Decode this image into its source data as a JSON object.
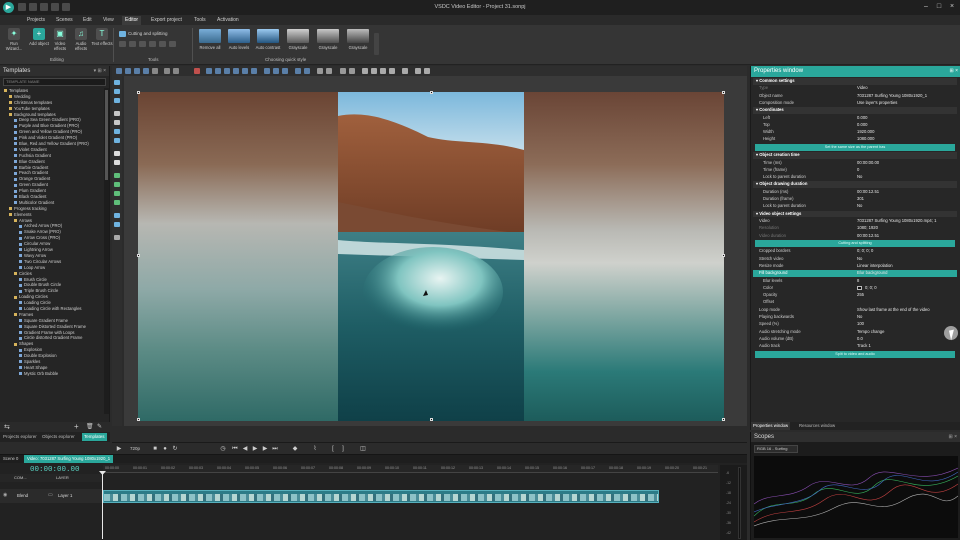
{
  "window": {
    "title": "VSDC Video Editor - Project 31.sonpj"
  },
  "menu_tabs": [
    "Projects",
    "Scenes",
    "Edit",
    "View",
    "Editor",
    "Export project",
    "Tools",
    "Activation"
  ],
  "active_menu_tab": "Editor",
  "ribbon": {
    "run_wizard": "Run Wizard...",
    "add_object": "Add object",
    "video_effects": "Video effects",
    "audio_effects": "Audio effects",
    "text_effects": "Text effects",
    "editing_group": "Editing",
    "cutting_splitting": "Cutting and splitting",
    "tools_group": "Tools",
    "quick_style_group": "Choosing quick style",
    "quick_styles": [
      "Remove all",
      "Auto levels",
      "Auto contrast",
      "Grayscale",
      "Grayscale",
      "Grayscale"
    ]
  },
  "templates": {
    "title": "Templates",
    "search_placeholder": "TEMPLATE NAME",
    "items": [
      {
        "label": "Templates",
        "level": 0,
        "folder": true
      },
      {
        "label": "Wedding",
        "level": 1,
        "folder": true
      },
      {
        "label": "Christmas templates",
        "level": 1,
        "folder": true
      },
      {
        "label": "YouTube templates",
        "level": 1,
        "folder": true
      },
      {
        "label": "Background templates",
        "level": 1,
        "folder": true
      },
      {
        "label": "Deep Sea Green Gradient (PRO)",
        "level": 2,
        "folder": false
      },
      {
        "label": "Purple and Blue Gradient (PRO)",
        "level": 2,
        "folder": false
      },
      {
        "label": "Green and Yellow Gradient (PRO)",
        "level": 2,
        "folder": false
      },
      {
        "label": "Pink and Violet Gradient (PRO)",
        "level": 2,
        "folder": false
      },
      {
        "label": "Blue, Red and Yellow Gradient (PRO)",
        "level": 2,
        "folder": false
      },
      {
        "label": "Violet Gradient",
        "level": 2,
        "folder": false
      },
      {
        "label": "Fuchsia Gradient",
        "level": 2,
        "folder": false
      },
      {
        "label": "Blue Gradient",
        "level": 2,
        "folder": false
      },
      {
        "label": "Barbie Gradient",
        "level": 2,
        "folder": false
      },
      {
        "label": "Peach Gradient",
        "level": 2,
        "folder": false
      },
      {
        "label": "Orange Gradient",
        "level": 2,
        "folder": false
      },
      {
        "label": "Green Gradient",
        "level": 2,
        "folder": false
      },
      {
        "label": "Plum Gradient",
        "level": 2,
        "folder": false
      },
      {
        "label": "Black Gradient",
        "level": 2,
        "folder": false
      },
      {
        "label": "Multicolor Gradient",
        "level": 2,
        "folder": false
      },
      {
        "label": "Progress tracking",
        "level": 1,
        "folder": true
      },
      {
        "label": "Elements",
        "level": 1,
        "folder": true
      },
      {
        "label": "Arrows",
        "level": 2,
        "folder": true
      },
      {
        "label": "Arched Arrow (PRO)",
        "level": 3,
        "folder": false
      },
      {
        "label": "Snake Arrow (PRO)",
        "level": 3,
        "folder": false
      },
      {
        "label": "Arrow Cross (PRO)",
        "level": 3,
        "folder": false
      },
      {
        "label": "Circular Arrow",
        "level": 3,
        "folder": false
      },
      {
        "label": "Lightning Arrow",
        "level": 3,
        "folder": false
      },
      {
        "label": "Wavy Arrow",
        "level": 3,
        "folder": false
      },
      {
        "label": "Two Circular Arrows",
        "level": 3,
        "folder": false
      },
      {
        "label": "Loop Arrow",
        "level": 3,
        "folder": false
      },
      {
        "label": "Circles",
        "level": 2,
        "folder": true
      },
      {
        "label": "Brush Circle",
        "level": 3,
        "folder": false
      },
      {
        "label": "Double Brush Circle",
        "level": 3,
        "folder": false
      },
      {
        "label": "Triple Brush Circle",
        "level": 3,
        "folder": false
      },
      {
        "label": "Loading Circles",
        "level": 2,
        "folder": true
      },
      {
        "label": "Loading Circle",
        "level": 3,
        "folder": false
      },
      {
        "label": "Loading Circle with Rectangles",
        "level": 3,
        "folder": false
      },
      {
        "label": "Frames",
        "level": 2,
        "folder": true
      },
      {
        "label": "Square Gradient Frame",
        "level": 3,
        "folder": false
      },
      {
        "label": "Square Distorted Gradient Frame",
        "level": 3,
        "folder": false
      },
      {
        "label": "Gradient Frame with Loops",
        "level": 3,
        "folder": false
      },
      {
        "label": "Circle distorted Gradient Frame",
        "level": 3,
        "folder": false
      },
      {
        "label": "Shapes",
        "level": 2,
        "folder": true
      },
      {
        "label": "Explosion",
        "level": 3,
        "folder": false
      },
      {
        "label": "Double Explosion",
        "level": 3,
        "folder": false
      },
      {
        "label": "Sparkles",
        "level": 3,
        "folder": false
      },
      {
        "label": "Heart Shape",
        "level": 3,
        "folder": false
      },
      {
        "label": "Mystic Orb Bubble",
        "level": 3,
        "folder": false
      }
    ],
    "bottom_tabs": [
      "Projects explorer",
      "Objects explorer",
      "Templates"
    ],
    "active_bottom_tab": "Templates"
  },
  "transport": {
    "zoom": "720p"
  },
  "properties": {
    "title": "Properties window",
    "rows": [
      {
        "kind": "section",
        "key": "Common settings"
      },
      {
        "kind": "dim",
        "key": "Type",
        "value": "Video"
      },
      {
        "kind": "row",
        "key": "Object name",
        "value": "7031287 Surfing Young 1080x1920_1"
      },
      {
        "kind": "row",
        "key": "Composition mode",
        "value": "Use layer's properties"
      },
      {
        "kind": "section",
        "key": "Coordinates"
      },
      {
        "kind": "sub",
        "key": "Left",
        "value": "0.000"
      },
      {
        "kind": "sub",
        "key": "Top",
        "value": "0.000"
      },
      {
        "kind": "sub",
        "key": "Width",
        "value": "1920.000"
      },
      {
        "kind": "sub",
        "key": "Height",
        "value": "1080.000"
      },
      {
        "kind": "button",
        "key": "Set the same size as the parent has"
      },
      {
        "kind": "section",
        "key": "Object creation time"
      },
      {
        "kind": "sub",
        "key": "Time (ms)",
        "value": "00:00:00.00"
      },
      {
        "kind": "sub",
        "key": "Time (frame)",
        "value": "0"
      },
      {
        "kind": "sub",
        "key": "Lock to parent duration",
        "value": "No"
      },
      {
        "kind": "section",
        "key": "Object drawing duration"
      },
      {
        "kind": "sub",
        "key": "Duration (ms)",
        "value": "00:00:12.51"
      },
      {
        "kind": "sub",
        "key": "Duration (frame)",
        "value": "301"
      },
      {
        "kind": "sub",
        "key": "Lock to parent duration",
        "value": "No"
      },
      {
        "kind": "section",
        "key": "Video object settings"
      },
      {
        "kind": "row",
        "key": "Video",
        "value": "7031287 Surfing Young 1080x1920.mp4; 1"
      },
      {
        "kind": "dim",
        "key": "Resolution",
        "value": "1080; 1920"
      },
      {
        "kind": "dim",
        "key": "Video duration",
        "value": "00:00:12.51"
      },
      {
        "kind": "button",
        "key": "Cutting and splitting"
      },
      {
        "kind": "row",
        "key": "Cropped borders",
        "value": "0; 0; 0; 0"
      },
      {
        "kind": "row",
        "key": "Stretch video",
        "value": "No"
      },
      {
        "kind": "row",
        "key": "Resize mode",
        "value": "Linear interpolation"
      },
      {
        "kind": "sel",
        "key": "Fill background",
        "value": "Blur background"
      },
      {
        "kind": "sub",
        "key": "Blur levels",
        "value": "8"
      },
      {
        "kind": "swatch",
        "key": "Color",
        "value": "0; 0; 0"
      },
      {
        "kind": "sub",
        "key": "Opacity",
        "value": "255"
      },
      {
        "kind": "sub",
        "key": "Offset",
        "value": ""
      },
      {
        "kind": "row",
        "key": "Loop mode",
        "value": "Show last frame at the end of the video"
      },
      {
        "kind": "row",
        "key": "Playing backwards",
        "value": "No"
      },
      {
        "kind": "row",
        "key": "Speed (%)",
        "value": "100"
      },
      {
        "kind": "row",
        "key": "Audio stretching mode",
        "value": "Tempo change"
      },
      {
        "kind": "row",
        "key": "Audio volume (dB)",
        "value": "0.0"
      },
      {
        "kind": "row",
        "key": "Audio track",
        "value": "Track 1"
      },
      {
        "kind": "button",
        "key": "Split to video and audio"
      }
    ],
    "footer_tabs": [
      "Properties window",
      "Resources window"
    ],
    "active_footer_tab": "Properties window"
  },
  "scopes": {
    "title": "Scopes",
    "selector": "RGB 16 - Surfing"
  },
  "timeline": {
    "tabs": [
      "Scene 0",
      "Video: 7031287 Surfing Young 1080x1920_1"
    ],
    "time": "00:00:00.00",
    "header_label": "COM...",
    "layer_header": "LAYER",
    "track_name": "Blend",
    "layer_name": "Layer 1",
    "ruler": [
      "00:00:00",
      "00:00:01",
      "00:00:02",
      "00:00:03",
      "00:00:04",
      "00:00:05",
      "00:00:06",
      "00:00:07",
      "00:00:08",
      "00:00:09",
      "00:00:10",
      "00:00:11",
      "00:00:12",
      "00:00:13",
      "00:00:14",
      "00:00:15",
      "00:00:16",
      "00:00:17",
      "00:00:18",
      "00:00:19",
      "00:00:20",
      "00:00:21"
    ],
    "vu_labels": [
      "-6",
      "-12",
      "-18",
      "-24",
      "-30",
      "-36",
      "-42"
    ]
  },
  "colors": {
    "accent": "#2aa79b",
    "background": "#2b2b2b"
  }
}
